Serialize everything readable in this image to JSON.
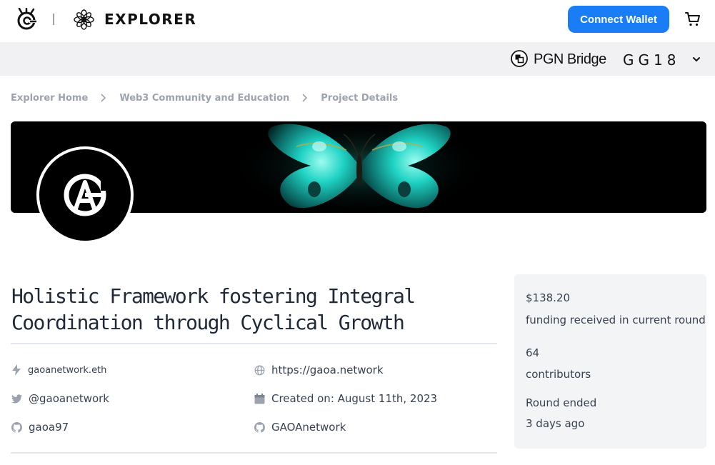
{
  "header": {
    "brand": "EXPLORER",
    "connect_label": "Connect Wallet",
    "icons": {
      "logo": "gitcoin-logo-icon",
      "explorer": "flower-icon",
      "cart": "cart-icon"
    }
  },
  "subheader": {
    "bridge_label": "PGN Bridge",
    "account_label": "GG18",
    "icons": {
      "bridge": "pgn-icon",
      "chevron": "chevron-down-icon"
    }
  },
  "breadcrumb": [
    "Explorer Home",
    "Web3 Community and Education",
    "Project Details"
  ],
  "project": {
    "title_line1": "Holistic Framework fostering Integral",
    "title_line2": "Coordination through Cyclical Growth",
    "details": {
      "ens": "gaoanetwork.eth",
      "website": "https://gaoa.network",
      "twitter": "@gaoanetwork",
      "created": "Created on: August 11th, 2023",
      "github_user": "gaoa97",
      "github_org": "GAOAnetwork"
    }
  },
  "stats": {
    "funding_amount": "$138.20",
    "funding_label": "funding received in current round",
    "contributors_count": "64",
    "contributors_label": "contributors",
    "round_status": "Round ended",
    "round_time": "3 days ago"
  },
  "colors": {
    "accent": "#1a7df5",
    "subbar": "#f1f1f3",
    "card": "#f3f4f6",
    "banner_glow": "#2fe6d0"
  }
}
